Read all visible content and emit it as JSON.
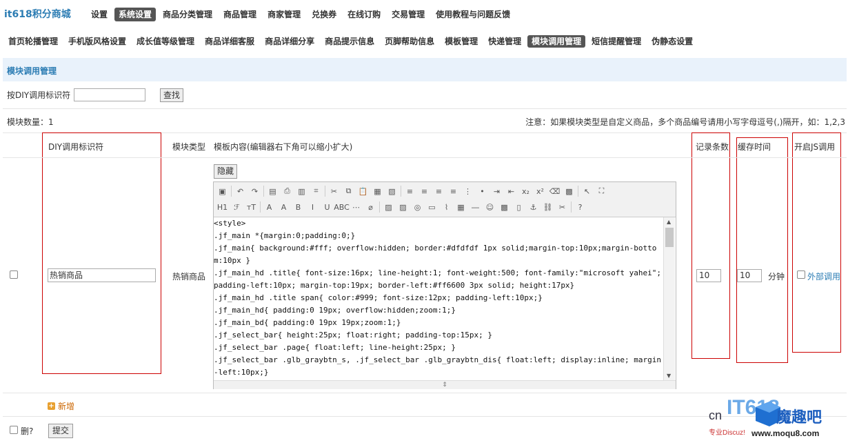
{
  "brand": "it618积分商城",
  "top_nav": [
    {
      "label": "设置",
      "active": false
    },
    {
      "label": "系统设置",
      "active": true
    },
    {
      "label": "商品分类管理",
      "active": false
    },
    {
      "label": "商品管理",
      "active": false
    },
    {
      "label": "商家管理",
      "active": false
    },
    {
      "label": "兑换券",
      "active": false
    },
    {
      "label": "在线订购",
      "active": false
    },
    {
      "label": "交易管理",
      "active": false
    },
    {
      "label": "使用教程与问题反馈",
      "active": false
    }
  ],
  "sub_nav": [
    {
      "label": "首页轮播管理",
      "active": false
    },
    {
      "label": "手机版风格设置",
      "active": false
    },
    {
      "label": "成长值等级管理",
      "active": false
    },
    {
      "label": "商品详细客服",
      "active": false
    },
    {
      "label": "商品详细分享",
      "active": false
    },
    {
      "label": "商品提示信息",
      "active": false
    },
    {
      "label": "页脚帮助信息",
      "active": false
    },
    {
      "label": "模板管理",
      "active": false
    },
    {
      "label": "快递管理",
      "active": false
    },
    {
      "label": "模块调用管理",
      "active": true
    },
    {
      "label": "短信提醒管理",
      "active": false
    },
    {
      "label": "伪静态设置",
      "active": false
    }
  ],
  "section_title": "模块调用管理",
  "search": {
    "label": "按DIY调用标识符",
    "value": "",
    "button": "查找"
  },
  "count_text": "模块数量：1",
  "notice": "注意：如果模块类型是自定义商品，多个商品编号请用小写字母逗号(,)隔开，如：1,2,3",
  "headers": {
    "diy": "DIY调用标识符",
    "type": "模块类型",
    "content": "模板内容(编辑器右下角可以缩小扩大)",
    "records": "记录条数",
    "cache": "缓存时间",
    "js": "开启JS调用"
  },
  "row": {
    "diy_value": "热销商品",
    "type": "热销商品",
    "hide_button": "隐藏",
    "records": "10",
    "cache": "10",
    "cache_unit": "分钟",
    "js_label": "外部调用",
    "js_checked": false,
    "code": "<style>\n.jf_main *{margin:0;padding:0;}\n.jf_main{ background:#fff; overflow:hidden; border:#dfdfdf 1px solid;margin-top:10px;margin-bottom:10px }\n.jf_main_hd .title{ font-size:16px; line-height:1; font-weight:500; font-family:\"microsoft yahei\"; padding-left:10px; margin-top:19px; border-left:#ff6600 3px solid; height:17px}\n.jf_main_hd .title span{ color:#999; font-size:12px; padding-left:10px;}\n.jf_main_hd{ padding:0 19px; overflow:hidden;zoom:1;}\n.jf_main_bd{ padding:0 19px 19px;zoom:1;}\n.jf_select_bar{ height:25px; float:right; padding-top:15px; }\n.jf_select_bar .page{ float:left; line-height:25px; }\n.jf_select_bar .glb_graybtn_s, .jf_select_bar .glb_graybtn_dis{ float:left; display:inline; margin-left:10px;}"
  },
  "add_label": "新增",
  "delete_label": "删?",
  "submit_label": "提交",
  "watermark": {
    "prefix": "cn",
    "big": "IT618",
    "cn": "魔趣吧",
    "sub": "专业Discuz!",
    "url": "www.moqu8.com"
  },
  "colors": {
    "accent": "#2b7cb3",
    "red_box": "#cc0000",
    "active_tab": "#555555",
    "section_bg": "#e9f2fb"
  }
}
